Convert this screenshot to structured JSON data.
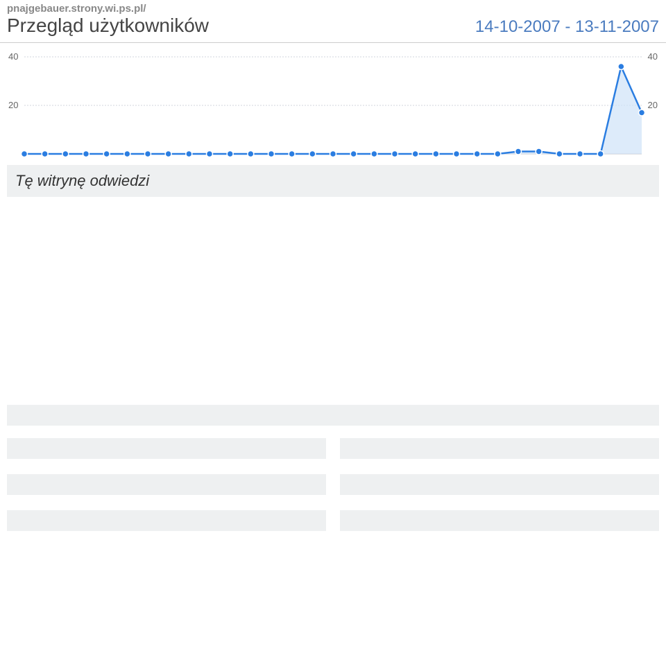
{
  "header": {
    "breadcrumb": "pnajgebauer.strony.wi.ps.pl/",
    "title": "Przegląd użytkowników",
    "date_range": "14-10-2007 - 13-11-2007"
  },
  "summary": {
    "text": "Tę witrynę odwiedzi"
  },
  "chart_data": {
    "type": "line",
    "title": "",
    "xlabel": "",
    "ylabel": "",
    "ylim": [
      0,
      40
    ],
    "y_ticks_left": [
      20,
      40
    ],
    "y_ticks_right": [
      20,
      40
    ],
    "x": [
      0,
      1,
      2,
      3,
      4,
      5,
      6,
      7,
      8,
      9,
      10,
      11,
      12,
      13,
      14,
      15,
      16,
      17,
      18,
      19,
      20,
      21,
      22,
      23,
      24,
      25,
      26,
      27,
      28,
      29,
      30
    ],
    "values": [
      0,
      0,
      0,
      0,
      0,
      0,
      0,
      0,
      0,
      0,
      0,
      0,
      0,
      0,
      0,
      0,
      0,
      0,
      0,
      0,
      0,
      0,
      0,
      0,
      1,
      1,
      0,
      0,
      0,
      36,
      17
    ]
  }
}
